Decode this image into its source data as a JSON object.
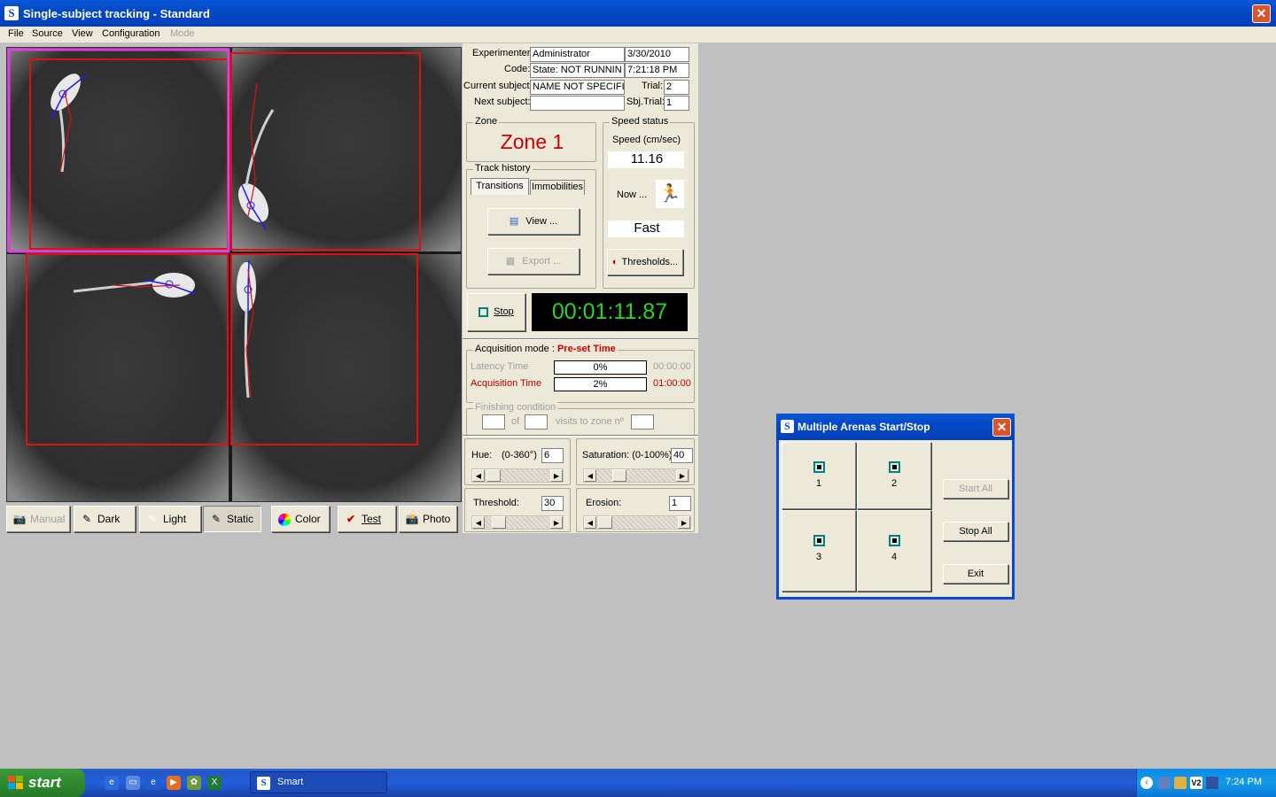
{
  "window": {
    "title": "Single-subject tracking - Standard",
    "app_icon": "smart-logo-icon"
  },
  "menu": [
    {
      "label": "File",
      "enabled": true
    },
    {
      "label": "Source",
      "enabled": true
    },
    {
      "label": "View",
      "enabled": true
    },
    {
      "label": "Configuration",
      "enabled": true
    },
    {
      "label": "Mode",
      "enabled": false
    }
  ],
  "toolbar": {
    "manual": "Manual",
    "dark": "Dark",
    "light": "Light",
    "static": "Static",
    "color": "Color",
    "test": "Test",
    "photo": "Photo"
  },
  "info": {
    "experimenter_label": "Experimenter:",
    "experimenter": "Administrator",
    "date": "3/30/2010",
    "code_label": "Code:",
    "code": "State: NOT RUNNIN",
    "time": "7:21:18 PM",
    "current_subject_label": "Current subject:",
    "current_subject": "NAME NOT SPECIFI",
    "trial_label": "Trial:",
    "trial": "2",
    "next_subject_label": "Next subject:",
    "next_subject": "",
    "sbj_trial_label": "Sbj.Trial:",
    "sbj_trial": "1"
  },
  "zone": {
    "group_label": "Zone",
    "value": "Zone 1"
  },
  "track_history": {
    "group_label": "Track history",
    "tabs": [
      "Transitions",
      "Immobilities"
    ],
    "view_button": "View ...",
    "export_button": "Export ..."
  },
  "speed": {
    "group_label": "Speed status",
    "speed_label": "Speed (cm/sec)",
    "speed_value": "11.16",
    "now_label": "Now ...",
    "status": "Fast",
    "thresholds_button": "Thresholds..."
  },
  "control": {
    "stop_button": "Stop",
    "timer": "00:01:11.87"
  },
  "acquisition": {
    "mode_label": "Acquisition mode :",
    "mode_value": "Pre-set Time",
    "latency_label": "Latency Time",
    "latency_progress": "0%",
    "latency_progress_fraction": 0,
    "latency_time": "00:00:00",
    "acq_label": "Acquisition Time",
    "acq_progress": "2%",
    "acq_progress_fraction": 0.02,
    "acq_time": "01:00:00",
    "finishing_label": "Finishing condition",
    "of_label": "of",
    "visits_label": "visits to zone nº"
  },
  "color_settings": {
    "hue_label": "Hue:",
    "hue_range": "(0-360°)",
    "hue_value": "6",
    "saturation_label": "Saturation: (0-100%)",
    "saturation_value": "40",
    "threshold_label": "Threshold:",
    "threshold_value": "30",
    "erosion_label": "Erosion:",
    "erosion_value": "1"
  },
  "dialog": {
    "title": "Multiple Arenas Start/Stop",
    "arenas": [
      "1",
      "2",
      "3",
      "4"
    ],
    "start_all": "Start All",
    "stop_all": "Stop All",
    "exit": "Exit"
  },
  "taskbar": {
    "start": "start",
    "task": "Smart",
    "clock": "7:24 PM"
  },
  "colors": {
    "timer_text": "#22d622",
    "zone_text": "#d00000",
    "arena_outline": "#e01010",
    "selected_arena": "#e040e0",
    "track_blue": "#1a1aff"
  }
}
